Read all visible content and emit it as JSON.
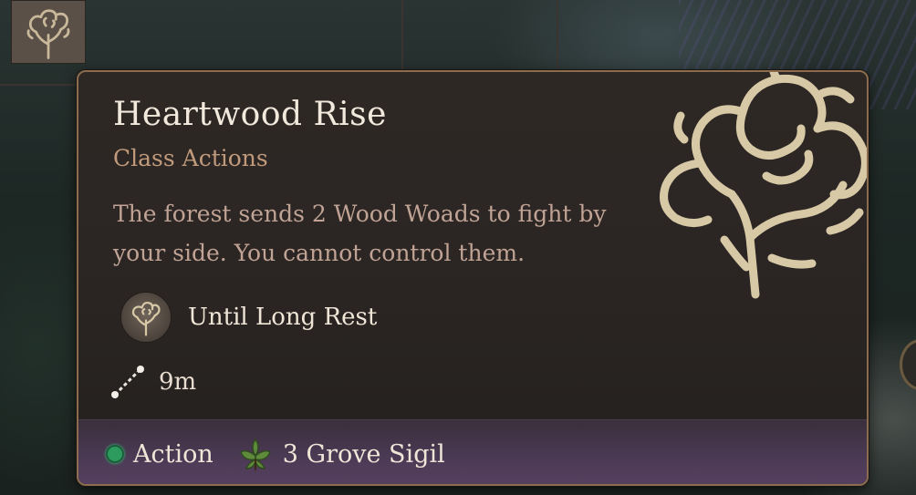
{
  "tooltip": {
    "title": "Heartwood Rise",
    "category": "Class Actions",
    "description": "The forest sends 2 Wood Woads to fight by your side. You cannot control them.",
    "duration": "Until Long Rest",
    "range": "9m",
    "cost_action": "Action",
    "cost_resource": "3 Grove Sigil"
  },
  "icons": {
    "emblem": "tree-emblem-icon",
    "duration": "tree-emblem-icon",
    "range": "range-dots-icon",
    "action": "action-dot-icon",
    "resource": "leaf-sigil-icon",
    "hotbar": "tree-emblem-icon"
  },
  "colors": {
    "tooltip_bg": "#2a2523",
    "border": "#8b6c4e",
    "title": "#f2e9dd",
    "subtitle": "#c09a7b",
    "description": "#c0a394",
    "footer": "#4c3a55",
    "action_dot": "#2d9a5e",
    "emblem": "#d8c9a6"
  }
}
